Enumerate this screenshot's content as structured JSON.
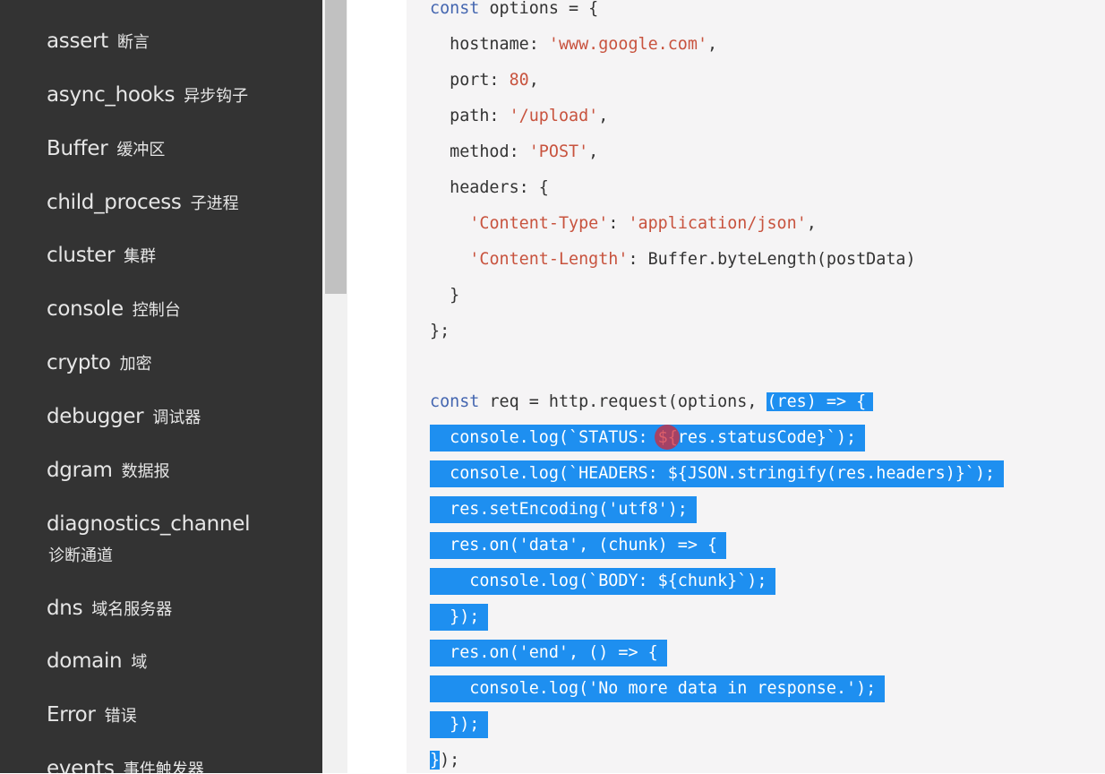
{
  "sidebar": {
    "items": [
      {
        "name": "assert",
        "zh": "断言"
      },
      {
        "name": "async_hooks",
        "zh": "异步钩子"
      },
      {
        "name": "Buffer",
        "zh": "缓冲区"
      },
      {
        "name": "child_process",
        "zh": "子进程"
      },
      {
        "name": "cluster",
        "zh": "集群"
      },
      {
        "name": "console",
        "zh": "控制台"
      },
      {
        "name": "crypto",
        "zh": "加密"
      },
      {
        "name": "debugger",
        "zh": "调试器"
      },
      {
        "name": "dgram",
        "zh": "数据报"
      },
      {
        "name": "diagnostics_channel",
        "zh": "诊断通道"
      },
      {
        "name": "dns",
        "zh": "域名服务器"
      },
      {
        "name": "domain",
        "zh": "域"
      },
      {
        "name": "Error",
        "zh": "错误"
      },
      {
        "name": "events",
        "zh": "事件触发器"
      }
    ]
  },
  "code": {
    "l1_kw": "const",
    "l1_rest": " options = {",
    "l2_key": "  hostname: ",
    "l2_val": "'www.google.com'",
    "l2_end": ",",
    "l3_key": "  port: ",
    "l3_val": "80",
    "l3_end": ",",
    "l4_key": "  path: ",
    "l4_val": "'/upload'",
    "l4_end": ",",
    "l5_key": "  method: ",
    "l5_val": "'POST'",
    "l5_end": ",",
    "l6": "  headers: {",
    "l7_indent": "    ",
    "l7_key": "'Content-Type'",
    "l7_mid": ": ",
    "l7_val": "'application/json'",
    "l7_end": ",",
    "l8_indent": "    ",
    "l8_key": "'Content-Length'",
    "l8_rest": ": Buffer.byteLength(postData)",
    "l9": "  }",
    "l10": "};",
    "l11_kw": "const",
    "l11_rest": " req = http.request(options, ",
    "l11_sel": "(res) => {",
    "l12": "  console.log(`STATUS: ${res.statusCode}`);",
    "l13": "  console.log(`HEADERS: ${JSON.stringify(res.headers)}`);",
    "l14": "  res.setEncoding('utf8');",
    "l15": "  res.on('data', (chunk) => {",
    "l16": "    console.log(`BODY: ${chunk}`);",
    "l17": "  });",
    "l18": "  res.on('end', () => {",
    "l19": "    console.log('No more data in response.');",
    "l20": "  });",
    "l21_sel": "}",
    "l21_rest": ");"
  },
  "colors": {
    "sidebar_bg": "#333333",
    "code_bg": "#f5f4f5",
    "selection": "#1e8ff0",
    "keyword": "#4466b0",
    "string": "#c8533e"
  }
}
